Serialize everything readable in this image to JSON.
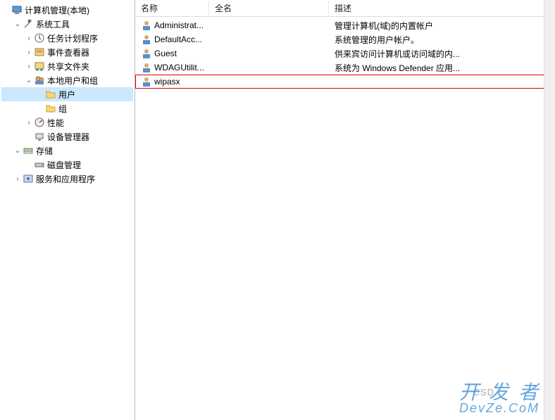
{
  "tree": {
    "root": {
      "label": "计算机管理(本地)",
      "icon": "computer-icon"
    },
    "system_tools": {
      "label": "系统工具",
      "icon": "wrench-icon"
    },
    "task_scheduler": {
      "label": "任务计划程序",
      "icon": "clock-icon"
    },
    "event_viewer": {
      "label": "事件查看器",
      "icon": "event-icon"
    },
    "shared_folders": {
      "label": "共享文件夹",
      "icon": "share-icon"
    },
    "local_users_groups": {
      "label": "本地用户和组",
      "icon": "users-icon"
    },
    "users": {
      "label": "用户",
      "icon": "folder-icon"
    },
    "groups": {
      "label": "组",
      "icon": "folder-icon"
    },
    "performance": {
      "label": "性能",
      "icon": "perf-icon"
    },
    "device_manager": {
      "label": "设备管理器",
      "icon": "device-icon"
    },
    "storage": {
      "label": "存储",
      "icon": "storage-icon"
    },
    "disk_management": {
      "label": "磁盘管理",
      "icon": "disk-icon"
    },
    "services_apps": {
      "label": "服务和应用程序",
      "icon": "services-icon"
    }
  },
  "columns": {
    "name": "名称",
    "fullname": "全名",
    "description": "描述"
  },
  "users_list": [
    {
      "name": "Administrat...",
      "fullname": "",
      "description": "管理计算机(域)的内置帐户"
    },
    {
      "name": "DefaultAcc...",
      "fullname": "",
      "description": "系统管理的用户帐户。"
    },
    {
      "name": "Guest",
      "fullname": "",
      "description": "供来宾访问计算机或访问域的内..."
    },
    {
      "name": "WDAGUtilit...",
      "fullname": "",
      "description": "系统为 Windows Defender 应用..."
    },
    {
      "name": "wipasx",
      "fullname": "",
      "description": ""
    }
  ],
  "watermark_main": "开发者",
  "watermark_sub": "DevZe.CoM",
  "watermark_csdn": "CSD"
}
